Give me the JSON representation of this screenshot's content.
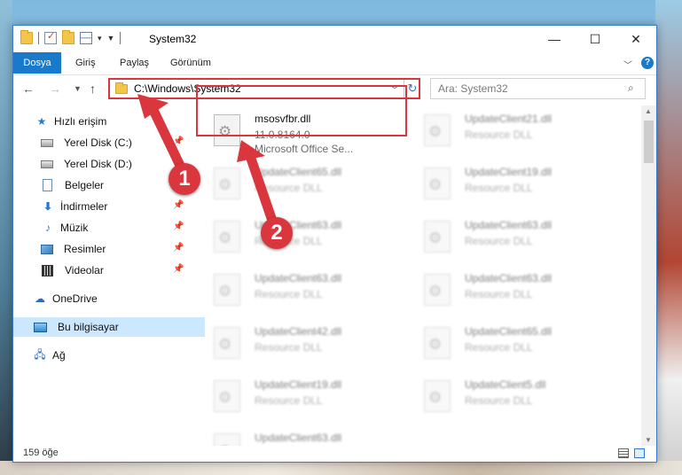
{
  "window": {
    "title": "System32",
    "minimize_icon": "minimize-icon",
    "maximize_icon": "maximize-icon",
    "close_icon": "close-icon"
  },
  "ribbon": {
    "tabs": [
      "Dosya",
      "Giriş",
      "Paylaş",
      "Görünüm"
    ],
    "file_tab_color": "#1979ca"
  },
  "address": {
    "path": "C:\\Windows\\System32",
    "search_placeholder": "Ara: System32"
  },
  "sidebar": {
    "items": [
      {
        "label": "Hızlı erişim",
        "icon": "star-icon"
      },
      {
        "label": "Yerel Disk (C:)",
        "icon": "drive-icon"
      },
      {
        "label": "Yerel Disk (D:)",
        "icon": "drive-icon"
      },
      {
        "label": "Belgeler",
        "icon": "documents-icon"
      },
      {
        "label": "İndirmeler",
        "icon": "download-icon"
      },
      {
        "label": "Müzik",
        "icon": "music-icon"
      },
      {
        "label": "Resimler",
        "icon": "pictures-icon"
      },
      {
        "label": "Videolar",
        "icon": "videos-icon"
      },
      {
        "label": "OneDrive",
        "icon": "cloud-icon"
      },
      {
        "label": "Bu bilgisayar",
        "icon": "computer-icon"
      },
      {
        "label": "Ağ",
        "icon": "network-icon"
      }
    ],
    "selected": "Bu bilgisayar"
  },
  "files": {
    "highlighted": {
      "name": "msosvfbr.dll",
      "version": "11.0.8164.0",
      "description": "Microsoft Office Se..."
    },
    "left_column": [
      {
        "name": "UpdateClient65.dll",
        "type": "Resource DLL"
      },
      {
        "name": "UpdateClient63.dll",
        "type": "Resource DLL"
      },
      {
        "name": "UpdateClient63.dll",
        "type": "Resource DLL"
      },
      {
        "name": "UpdateClient42.dll",
        "type": "Resource DLL"
      },
      {
        "name": "UpdateClient19.dll",
        "type": "Resource DLL"
      },
      {
        "name": "UpdateClient63.dll",
        "type": "Resource DLL"
      }
    ],
    "right_column": [
      {
        "name": "UpdateClient21.dll",
        "type": "Resource DLL"
      },
      {
        "name": "UpdateClient19.dll",
        "type": "Resource DLL"
      },
      {
        "name": "UpdateClient63.dll",
        "type": "Resource DLL"
      },
      {
        "name": "UpdateClient63.dll",
        "type": "Resource DLL"
      },
      {
        "name": "UpdateClient65.dll",
        "type": "Resource DLL"
      },
      {
        "name": "UpdateClient5.dll",
        "type": "Resource DLL"
      }
    ]
  },
  "status": {
    "item_count": "159 öğe"
  },
  "annotations": {
    "step1": "1",
    "step2": "2",
    "color": "#d9363e"
  }
}
